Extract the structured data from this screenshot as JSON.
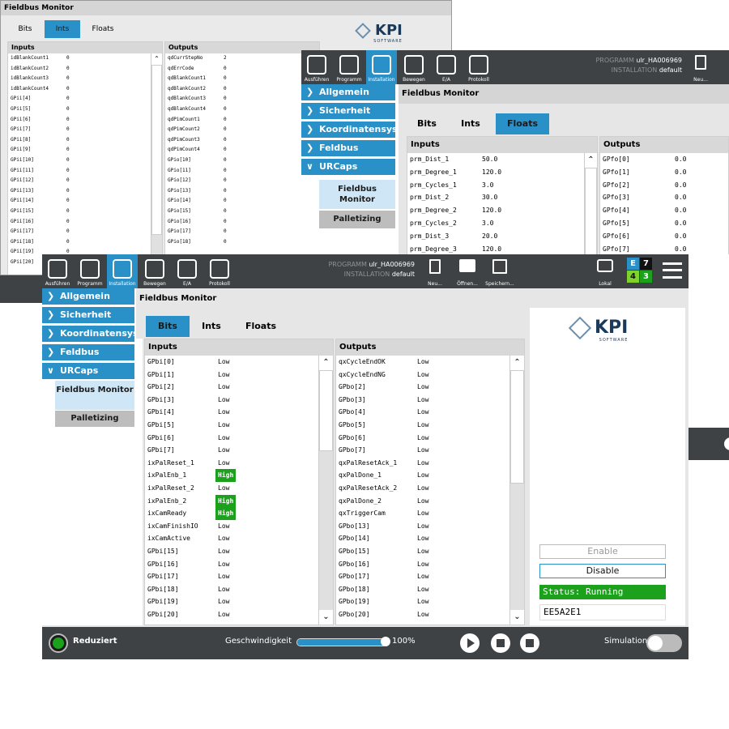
{
  "win1": {
    "title": "Fieldbus Monitor",
    "tabs": [
      "Bits",
      "Ints",
      "Floats"
    ],
    "active_tab": "Ints",
    "brand": "KPI",
    "brand_sub": "SOFTWARE",
    "inputs_header": "Inputs",
    "outputs_header": "Outputs",
    "inputs": [
      [
        "idBlankCount1",
        "0"
      ],
      [
        "idBlankCount2",
        "0"
      ],
      [
        "idBlankCount3",
        "0"
      ],
      [
        "idBlankCount4",
        "0"
      ],
      [
        "GPii[4]",
        "0"
      ],
      [
        "GPii[5]",
        "0"
      ],
      [
        "GPii[6]",
        "0"
      ],
      [
        "GPii[7]",
        "0"
      ],
      [
        "GPii[8]",
        "0"
      ],
      [
        "GPii[9]",
        "0"
      ],
      [
        "GPii[10]",
        "0"
      ],
      [
        "GPii[11]",
        "0"
      ],
      [
        "GPii[12]",
        "0"
      ],
      [
        "GPii[13]",
        "0"
      ],
      [
        "GPii[14]",
        "0"
      ],
      [
        "GPii[15]",
        "0"
      ],
      [
        "GPii[16]",
        "0"
      ],
      [
        "GPii[17]",
        "0"
      ],
      [
        "GPii[18]",
        "0"
      ],
      [
        "GPii[19]",
        "0"
      ],
      [
        "GPii[20]",
        "0"
      ]
    ],
    "outputs": [
      [
        "qdCurrStepNo",
        "2"
      ],
      [
        "qdErrCode",
        "0"
      ],
      [
        "qdBlankCount1",
        "0"
      ],
      [
        "qdBlankCount2",
        "0"
      ],
      [
        "qdBlankCount3",
        "0"
      ],
      [
        "qdBlankCount4",
        "0"
      ],
      [
        "qdPimCount1",
        "0"
      ],
      [
        "qdPimCount2",
        "0"
      ],
      [
        "qdPimCount3",
        "0"
      ],
      [
        "qdPimCount4",
        "0"
      ],
      [
        "GPio[10]",
        "0"
      ],
      [
        "GPio[11]",
        "0"
      ],
      [
        "GPio[12]",
        "0"
      ],
      [
        "GPio[13]",
        "0"
      ],
      [
        "GPio[14]",
        "0"
      ],
      [
        "GPio[15]",
        "0"
      ],
      [
        "GPio[16]",
        "0"
      ],
      [
        "GPio[17]",
        "0"
      ],
      [
        "GPio[18]",
        "0"
      ]
    ]
  },
  "win2": {
    "toolbar": [
      "Ausführen",
      "Programm",
      "Installation",
      "Bewegen",
      "E/A",
      "Protokoll"
    ],
    "program_label": "PROGRAMM",
    "program_value": "ulr_HA006969",
    "installation_label": "INSTALLATION",
    "installation_value": "default",
    "new_label": "Neu...",
    "sidebar": [
      "Allgemein",
      "Sicherheit",
      "Koordinatensys",
      "Feldbus",
      "URCaps"
    ],
    "sub_items": [
      "Fieldbus Monitor",
      "Palletizing"
    ],
    "title": "Fieldbus Monitor",
    "tabs": [
      "Bits",
      "Ints",
      "Floats"
    ],
    "active_tab": "Floats",
    "inputs_header": "Inputs",
    "outputs_header": "Outputs",
    "inputs": [
      [
        "prm_Dist_1",
        "50.0"
      ],
      [
        "prm_Degree_1",
        "120.0"
      ],
      [
        "prm_Cycles_1",
        "3.0"
      ],
      [
        "prm_Dist_2",
        "30.0"
      ],
      [
        "prm_Degree_2",
        "120.0"
      ],
      [
        "prm_Cycles_2",
        "3.0"
      ],
      [
        "prm_Dist_3",
        "20.0"
      ],
      [
        "prm_Degree_3",
        "120.0"
      ]
    ],
    "outputs": [
      [
        "GPfo[0]",
        "0.0"
      ],
      [
        "GPfo[1]",
        "0.0"
      ],
      [
        "GPfo[2]",
        "0.0"
      ],
      [
        "GPfo[3]",
        "0.0"
      ],
      [
        "GPfo[4]",
        "0.0"
      ],
      [
        "GPfo[5]",
        "0.0"
      ],
      [
        "GPfo[6]",
        "0.0"
      ],
      [
        "GPfo[7]",
        "0.0"
      ]
    ]
  },
  "win3": {
    "toolbar": [
      "Ausführen",
      "Programm",
      "Installation",
      "Bewegen",
      "E/A",
      "Protokoll"
    ],
    "program_label": "PROGRAMM",
    "program_value": "ulr_HA006969",
    "installation_label": "INSTALLATION",
    "installation_value": "default",
    "file_buttons": [
      "Neu...",
      "Öffnen...",
      "Speichern..."
    ],
    "local_label": "Lokal",
    "status_e": "E",
    "status_7": "7",
    "status_4": "4",
    "status_3": "3",
    "sidebar": [
      "Allgemein",
      "Sicherheit",
      "Koordinatensys",
      "Feldbus",
      "URCaps"
    ],
    "sub_items": [
      "Fieldbus Monitor",
      "Palletizing"
    ],
    "title": "Fieldbus Monitor",
    "tabs": [
      "Bits",
      "Ints",
      "Floats"
    ],
    "active_tab": "Bits",
    "brand": "KPI",
    "brand_sub": "SOFTWARE",
    "inputs_header": "Inputs",
    "outputs_header": "Outputs",
    "inputs": [
      [
        "GPbi[0]",
        "Low"
      ],
      [
        "GPbi[1]",
        "Low"
      ],
      [
        "GPbi[2]",
        "Low"
      ],
      [
        "GPbi[3]",
        "Low"
      ],
      [
        "GPbi[4]",
        "Low"
      ],
      [
        "GPbi[5]",
        "Low"
      ],
      [
        "GPbi[6]",
        "Low"
      ],
      [
        "GPbi[7]",
        "Low"
      ],
      [
        "ixPalReset_1",
        "Low"
      ],
      [
        "ixPalEnb_1",
        "High"
      ],
      [
        "ixPalReset_2",
        "Low"
      ],
      [
        "ixPalEnb_2",
        "High"
      ],
      [
        "ixCamReady",
        "High"
      ],
      [
        "ixCamFinishIO",
        "Low"
      ],
      [
        "ixCamActive",
        "Low"
      ],
      [
        "GPbi[15]",
        "Low"
      ],
      [
        "GPbi[16]",
        "Low"
      ],
      [
        "GPbi[17]",
        "Low"
      ],
      [
        "GPbi[18]",
        "Low"
      ],
      [
        "GPbi[19]",
        "Low"
      ],
      [
        "GPbi[20]",
        "Low"
      ]
    ],
    "outputs": [
      [
        "qxCycleEndOK",
        "Low"
      ],
      [
        "qxCycleEndNG",
        "Low"
      ],
      [
        "GPbo[2]",
        "Low"
      ],
      [
        "GPbo[3]",
        "Low"
      ],
      [
        "GPbo[4]",
        "Low"
      ],
      [
        "GPbo[5]",
        "Low"
      ],
      [
        "GPbo[6]",
        "Low"
      ],
      [
        "GPbo[7]",
        "Low"
      ],
      [
        "qxPalResetAck_1",
        "Low"
      ],
      [
        "qxPalDone_1",
        "Low"
      ],
      [
        "qxPalResetAck_2",
        "Low"
      ],
      [
        "qxPalDone_2",
        "Low"
      ],
      [
        "qxTriggerCam",
        "Low"
      ],
      [
        "GPbo[13]",
        "Low"
      ],
      [
        "GPbo[14]",
        "Low"
      ],
      [
        "GPbo[15]",
        "Low"
      ],
      [
        "GPbo[16]",
        "Low"
      ],
      [
        "GPbo[17]",
        "Low"
      ],
      [
        "GPbo[18]",
        "Low"
      ],
      [
        "GPbo[19]",
        "Low"
      ],
      [
        "GPbo[20]",
        "Low"
      ]
    ],
    "enable_label": "Enable",
    "disable_label": "Disable",
    "status_text": "Status: Running",
    "code": "EE5A2E1",
    "footer": {
      "mode": "Reduziert",
      "speed_label": "Geschwindigkeit",
      "speed_value": "100%",
      "simulation_label": "Simulation"
    },
    "speed_fraction": 1.0,
    "colors": {
      "accent": "#2a90c8",
      "toolbar": "#3e4244",
      "high": "#1ba11b",
      "status_ok": "#1ba11b"
    }
  }
}
